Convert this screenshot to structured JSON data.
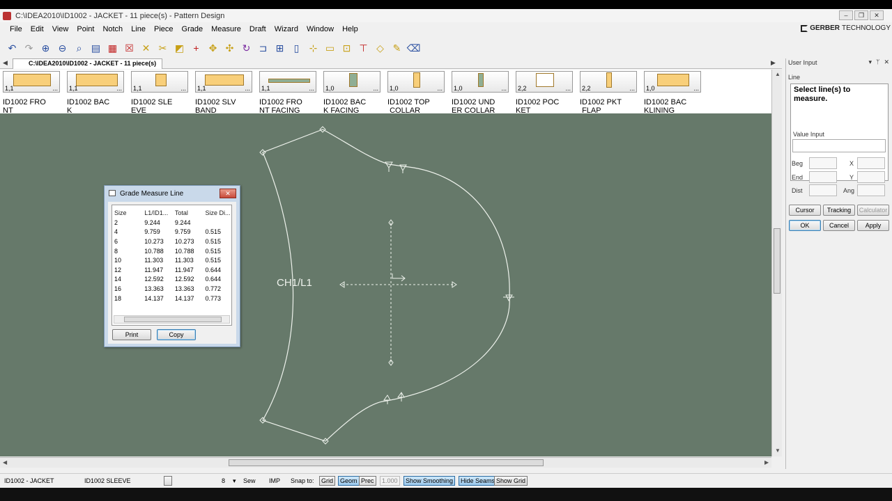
{
  "window": {
    "title": "C:\\IDEA2010\\ID1002 - JACKET  -  11 piece(s)  - Pattern Design",
    "controls": {
      "minimize": "–",
      "restore": "❐",
      "close": "✕"
    }
  },
  "menu": [
    "File",
    "Edit",
    "View",
    "Point",
    "Notch",
    "Line",
    "Piece",
    "Grade",
    "Measure",
    "Draft",
    "Wizard",
    "Window",
    "Help"
  ],
  "brand": {
    "name": "GERBER",
    "suffix": "TECHNOLOGY"
  },
  "toolbar_icons": [
    "undo-icon",
    "redo-icon",
    "zoom-in-icon",
    "zoom-out-icon",
    "zoom-window-icon",
    "sheet-icon",
    "piece-grid-icon",
    "delete-x-icon",
    "delete-points-icon",
    "scissors-icon",
    "piece-icon",
    "plus-icon",
    "move-icon",
    "move-all-icon",
    "rotate-icon",
    "bracket-icon",
    "add-point-icon",
    "vertical-bar-icon",
    "add-point-2-icon",
    "horizontal-bar-icon",
    "marker-icon",
    "tee-icon",
    "diamond-icon",
    "wand-icon",
    "eraser-icon"
  ],
  "doc_tab": {
    "label": "C:\\IDEA2010\\ID1002 - JACKET  -  11 piece(s)"
  },
  "pieces": [
    {
      "num": "1,1",
      "name": "ID1002 FRO\nNT"
    },
    {
      "num": "1,1",
      "name": "ID1002 BAC\nK"
    },
    {
      "num": "1,1",
      "name": "ID1002 SLE\nEVE"
    },
    {
      "num": "1,1",
      "name": "ID1002 SLV\nBAND"
    },
    {
      "num": "1,1",
      "name": "ID1002 FRO\nNT FACING"
    },
    {
      "num": "1,0",
      "name": "ID1002 BAC\nK FACING"
    },
    {
      "num": "1,0",
      "name": "ID1002 TOP\n COLLAR"
    },
    {
      "num": "1,0",
      "name": "ID1002 UND\nER COLLAR"
    },
    {
      "num": "2,2",
      "name": "ID1002 POC\nKET"
    },
    {
      "num": "2,2",
      "name": "ID1002 PKT\n FLAP"
    },
    {
      "num": "1,0",
      "name": "ID1002 BAC\nKLINING"
    }
  ],
  "canvas": {
    "label": "CH1/L1",
    "background": "#66796a"
  },
  "dialog": {
    "title": "Grade Measure Line",
    "close": "✕",
    "columns": [
      "Size",
      "L1/ID1...",
      "Total",
      "Size Di..."
    ],
    "rows": [
      [
        "2",
        "9.244",
        "9.244",
        ""
      ],
      [
        "4",
        "9.759",
        "9.759",
        "0.515"
      ],
      [
        "6",
        "10.273",
        "10.273",
        "0.515"
      ],
      [
        "8",
        "10.788",
        "10.788",
        "0.515"
      ],
      [
        "10",
        "11.303",
        "11.303",
        "0.515"
      ],
      [
        "12",
        "11.947",
        "11.947",
        "0.644"
      ],
      [
        "14",
        "12.592",
        "12.592",
        "0.644"
      ],
      [
        "16",
        "13.363",
        "13.363",
        "0.772"
      ],
      [
        "18",
        "14.137",
        "14.137",
        "0.773"
      ]
    ],
    "print": "Print",
    "copy": "Copy"
  },
  "user_input": {
    "title": "User Input",
    "pin": "ᛘ",
    "close": "✕",
    "dropdown": "▾",
    "section": "Line",
    "message": "Select line(s) to measure.",
    "value_input": "Value Input",
    "beg": "Beg",
    "end": "End",
    "dist": "Dist",
    "x": "X",
    "y": "Y",
    "ang": "Ang",
    "cursor": "Cursor",
    "tracking": "Tracking",
    "calculator": "Calculator",
    "ok": "OK",
    "cancel": "Cancel",
    "apply": "Apply"
  },
  "status": {
    "style": "ID1002 - JACKET",
    "piece": "ID1002 SLEEVE",
    "size": "8",
    "sew": "Sew",
    "imp": "IMP",
    "snap_to": "Snap to:",
    "grid": "Grid",
    "geom": "Geom",
    "prec": "Prec",
    "prec_value": "1.000",
    "show_smoothing": "Show Smoothing",
    "hide_seams": "Hide Seams",
    "show_grid": "Show Grid"
  }
}
